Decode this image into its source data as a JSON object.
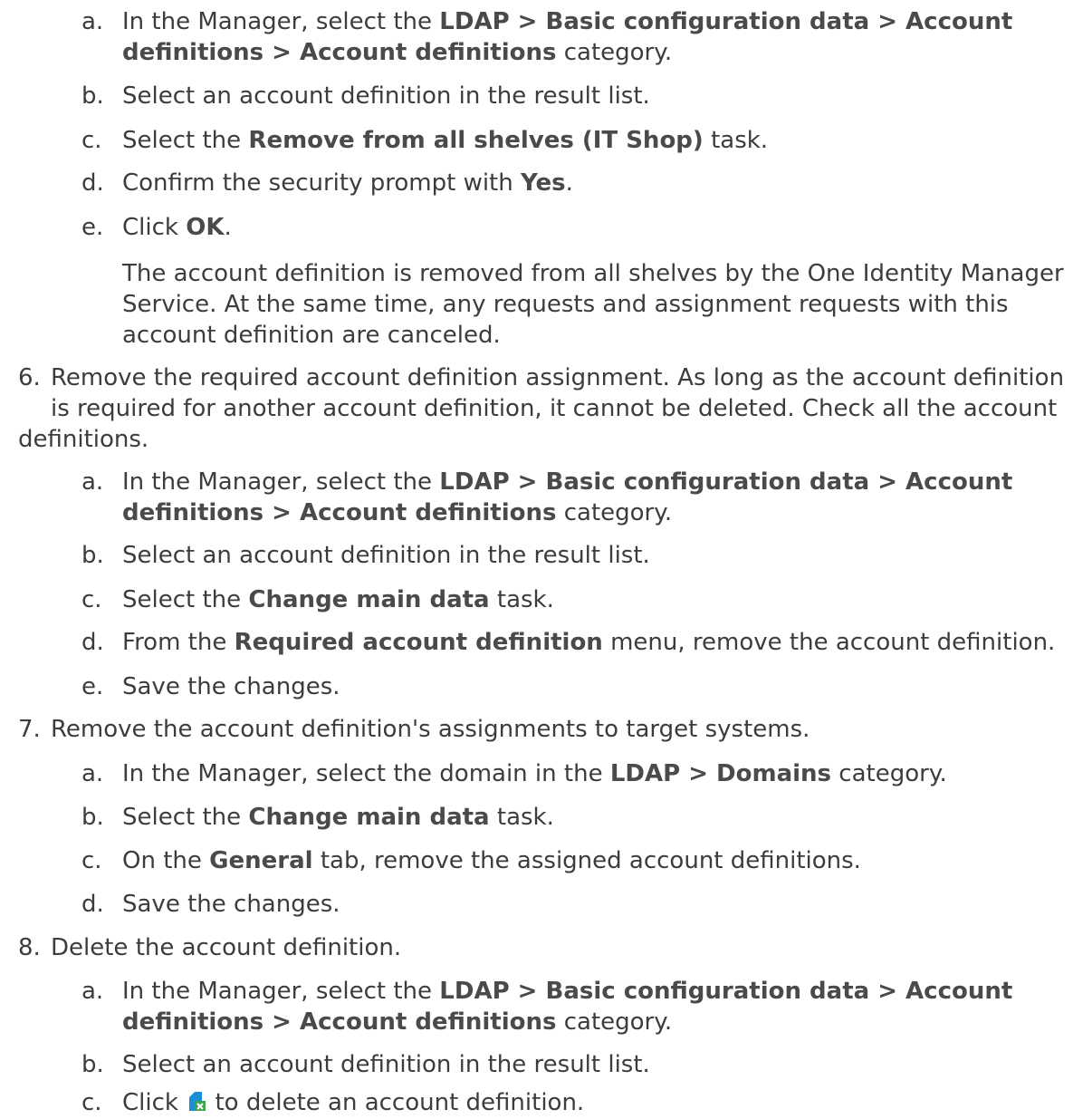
{
  "steps": {
    "s5a": {
      "marker": "a.",
      "p1": "In the Manager, select the ",
      "b1": "LDAP > Basic configuration data > Account",
      "b2": "definitions > Account definitions",
      "p2": " category."
    },
    "s5b": {
      "marker": "b.",
      "p1": "Select an account definition in the result list."
    },
    "s5c": {
      "marker": "c.",
      "p1": "Select the ",
      "b1": "Remove from all shelves (IT Shop)",
      "p2": " task."
    },
    "s5d": {
      "marker": "d.",
      "p1": "Confirm the security prompt with ",
      "b1": "Yes",
      "p2": "."
    },
    "s5e": {
      "marker": "e.",
      "p1": "Click ",
      "b1": "OK",
      "p2": "."
    },
    "s5note": {
      "l1": "The account definition is removed from all shelves by the One Identity Manager",
      "l2": "Service. At the same time, any requests and assignment requests with this",
      "l3": "account definition are canceled."
    },
    "s6": {
      "marker": "6.",
      "l1": "Remove the required account definition assignment. As long as the account definition",
      "l2": "is required for another account definition, it cannot be deleted. Check all the account",
      "l3": "definitions."
    },
    "s6a": {
      "marker": "a.",
      "p1": "In the Manager, select the ",
      "b1": "LDAP > Basic configuration data > Account",
      "b2": "definitions > Account definitions",
      "p2": " category."
    },
    "s6b": {
      "marker": "b.",
      "p1": "Select an account definition in the result list."
    },
    "s6c": {
      "marker": "c.",
      "p1": "Select the ",
      "b1": "Change main data",
      "p2": " task."
    },
    "s6d": {
      "marker": "d.",
      "p1": "From the ",
      "b1": "Required account definition",
      "p2": " menu, remove the account definition."
    },
    "s6e": {
      "marker": "e.",
      "p1": "Save the changes."
    },
    "s7": {
      "marker": "7.",
      "l1": "Remove the account definition's assignments to target systems."
    },
    "s7a": {
      "marker": "a.",
      "p1": "In the Manager, select the domain in the ",
      "b1": "LDAP > Domains",
      "p2": " category."
    },
    "s7b": {
      "marker": "b.",
      "p1": "Select the ",
      "b1": "Change main data",
      "p2": " task."
    },
    "s7c": {
      "marker": "c.",
      "p1": "On the ",
      "b1": "General",
      "p2": " tab, remove the assigned account definitions."
    },
    "s7d": {
      "marker": "d.",
      "p1": "Save the changes."
    },
    "s8": {
      "marker": "8.",
      "l1": "Delete the account definition."
    },
    "s8a": {
      "marker": "a.",
      "p1": "In the Manager, select the ",
      "b1": "LDAP > Basic configuration data > Account",
      "b2": "definitions > Account definitions",
      "p2": " category."
    },
    "s8b": {
      "marker": "b.",
      "p1": "Select an account definition in the result list."
    },
    "s8c": {
      "marker": "c.",
      "p1": "Click ",
      "icon": "delete-icon",
      "p2": " to delete an account definition."
    }
  },
  "colors": {
    "text": "#3c3c3c",
    "icon_blue": "#1a8fd6",
    "icon_green": "#3ba34a"
  }
}
